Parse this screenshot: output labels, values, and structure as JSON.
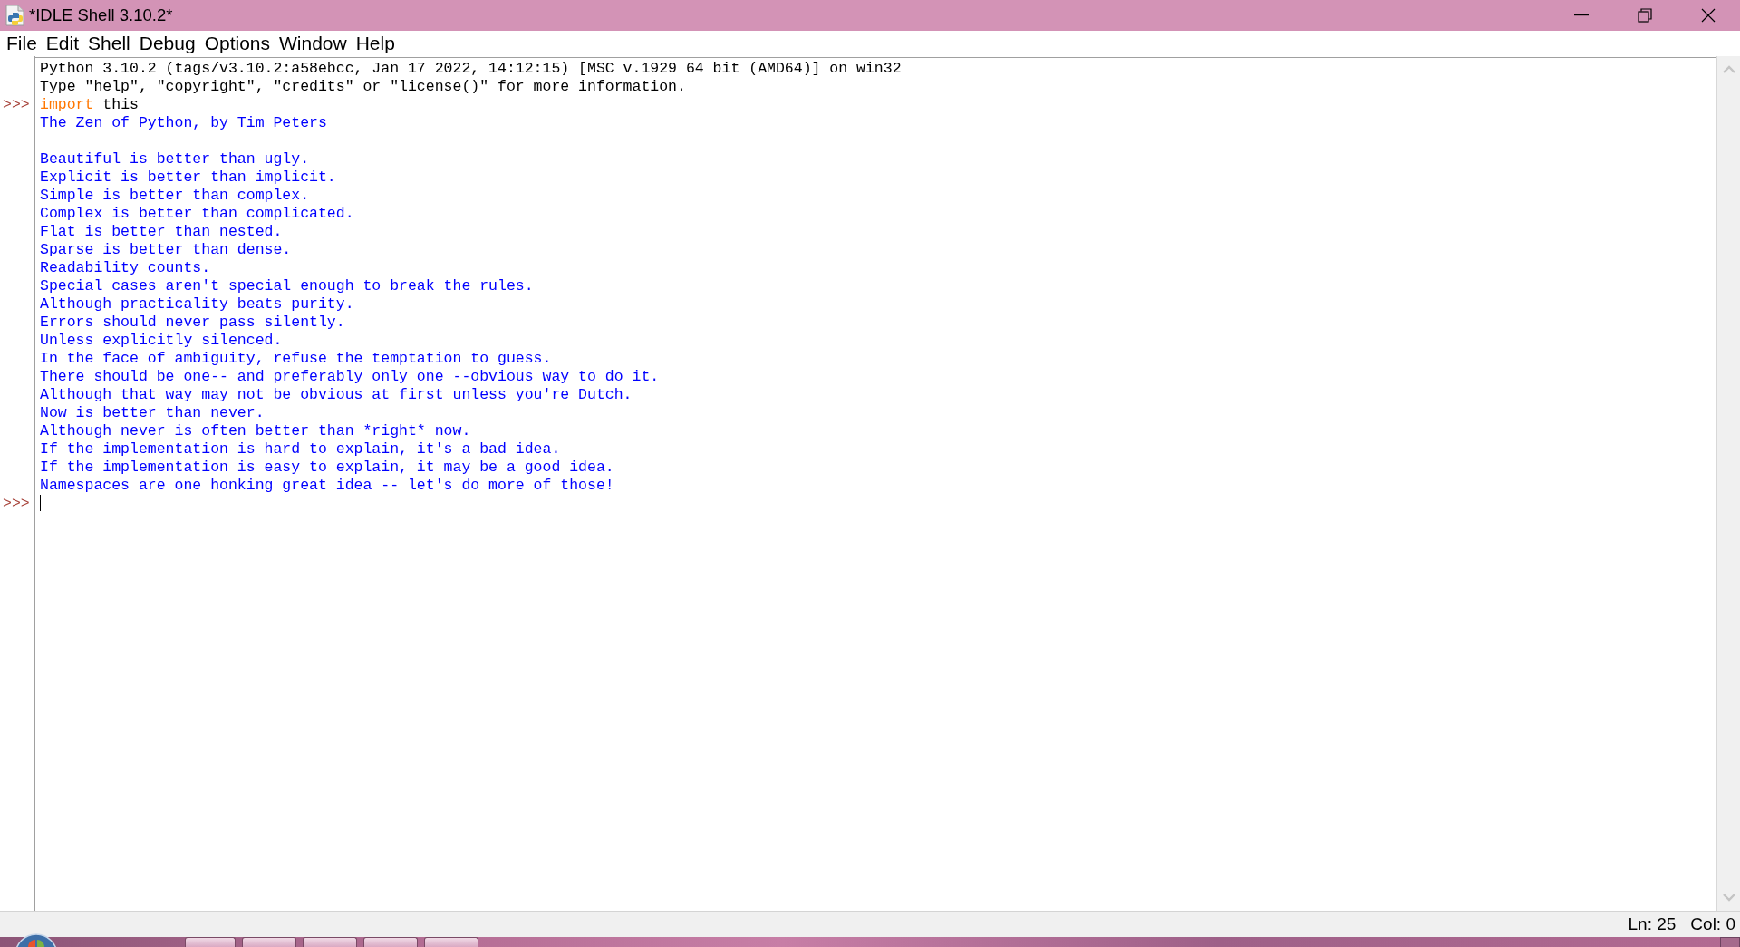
{
  "window": {
    "title": "*IDLE Shell 3.10.2*"
  },
  "menu": [
    "File",
    "Edit",
    "Shell",
    "Debug",
    "Options",
    "Window",
    "Help"
  ],
  "shell": {
    "lines": [
      {
        "kind": "banner",
        "text": "Python 3.10.2 (tags/v3.10.2:a58ebcc, Jan 17 2022, 14:12:15) [MSC v.1929 64 bit (AMD64)] on win32"
      },
      {
        "kind": "banner",
        "text": "Type \"help\", \"copyright\", \"credits\" or \"license()\" for more information."
      },
      {
        "kind": "input",
        "prompt": ">>>",
        "cursor": false,
        "code": [
          {
            "kind": "keyword",
            "text": "import"
          },
          {
            "kind": "name",
            "text": "this"
          }
        ]
      },
      {
        "kind": "output",
        "text": "The Zen of Python, by Tim Peters"
      },
      {
        "kind": "blank"
      },
      {
        "kind": "output",
        "text": "Beautiful is better than ugly."
      },
      {
        "kind": "output",
        "text": "Explicit is better than implicit."
      },
      {
        "kind": "output",
        "text": "Simple is better than complex."
      },
      {
        "kind": "output",
        "text": "Complex is better than complicated."
      },
      {
        "kind": "output",
        "text": "Flat is better than nested."
      },
      {
        "kind": "output",
        "text": "Sparse is better than dense."
      },
      {
        "kind": "output",
        "text": "Readability counts."
      },
      {
        "kind": "output",
        "text": "Special cases aren't special enough to break the rules."
      },
      {
        "kind": "output",
        "text": "Although practicality beats purity."
      },
      {
        "kind": "output",
        "text": "Errors should never pass silently."
      },
      {
        "kind": "output",
        "text": "Unless explicitly silenced."
      },
      {
        "kind": "output",
        "text": "In the face of ambiguity, refuse the temptation to guess."
      },
      {
        "kind": "output",
        "text": "There should be one-- and preferably only one --obvious way to do it."
      },
      {
        "kind": "output",
        "text": "Although that way may not be obvious at first unless you're Dutch."
      },
      {
        "kind": "output",
        "text": "Now is better than never."
      },
      {
        "kind": "output",
        "text": "Although never is often better than *right* now."
      },
      {
        "kind": "output",
        "text": "If the implementation is hard to explain, it's a bad idea."
      },
      {
        "kind": "output",
        "text": "If the implementation is easy to explain, it may be a good idea."
      },
      {
        "kind": "output",
        "text": "Namespaces are one honking great idea -- let's do more of those!"
      },
      {
        "kind": "input",
        "prompt": ">>>",
        "cursor": true
      }
    ]
  },
  "status_bar": {
    "line": "Ln: 25",
    "column": "Col: 0"
  }
}
